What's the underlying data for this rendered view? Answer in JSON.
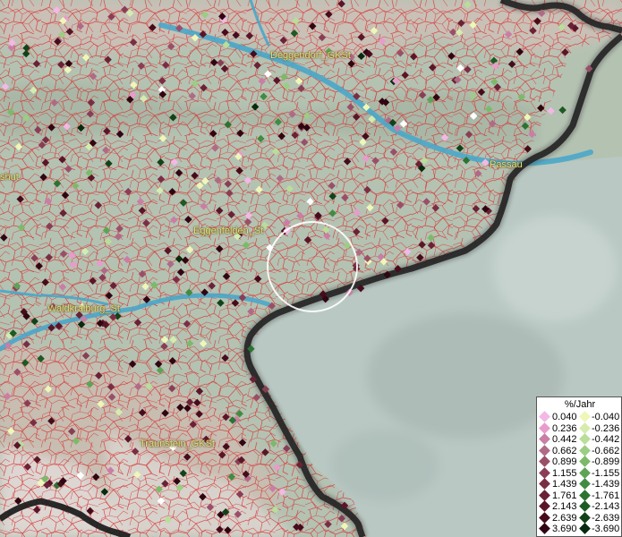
{
  "map": {
    "labels": [
      {
        "id": "deggendorf",
        "text": "Deggendorf_GKSt"
      },
      {
        "id": "passau",
        "text": "Passau"
      },
      {
        "id": "landshut",
        "text": "shut"
      },
      {
        "id": "eggenfelden",
        "text": "Eggenfelden_St"
      },
      {
        "id": "waldkraiburg",
        "text": "Waldkraiburg_St"
      },
      {
        "id": "traunstein",
        "text": "Traunstein_GKSt"
      }
    ]
  },
  "legend": {
    "title": "%/Jahr",
    "positive": [
      {
        "label": "0.040",
        "color": "#f2b8e6"
      },
      {
        "label": "0.236",
        "color": "#e79ccb"
      },
      {
        "label": "0.442",
        "color": "#c97ea6"
      },
      {
        "label": "0.662",
        "color": "#b06a86"
      },
      {
        "label": "0.899",
        "color": "#9a4f68"
      },
      {
        "label": "1.155",
        "color": "#8a3e55"
      },
      {
        "label": "1.439",
        "color": "#7a2e44"
      },
      {
        "label": "1.761",
        "color": "#6a2236"
      },
      {
        "label": "2.143",
        "color": "#5a1628"
      },
      {
        "label": "2.639",
        "color": "#460c1c"
      },
      {
        "label": "3.690",
        "color": "#300612"
      }
    ],
    "negative": [
      {
        "label": "-0.040",
        "color": "#eef7b8"
      },
      {
        "label": "-0.236",
        "color": "#d6ecae"
      },
      {
        "label": "-0.442",
        "color": "#b9de9a"
      },
      {
        "label": "-0.662",
        "color": "#9ccd84"
      },
      {
        "label": "-0.899",
        "color": "#7cba6a"
      },
      {
        "label": "-1.155",
        "color": "#5ea356"
      },
      {
        "label": "-1.439",
        "color": "#418c42"
      },
      {
        "label": "-1.761",
        "color": "#2c7332"
      },
      {
        "label": "-2.143",
        "color": "#1d5a24"
      },
      {
        "label": "-2.639",
        "color": "#124218"
      },
      {
        "label": "-3.690",
        "color": "#082a0e"
      }
    ]
  }
}
